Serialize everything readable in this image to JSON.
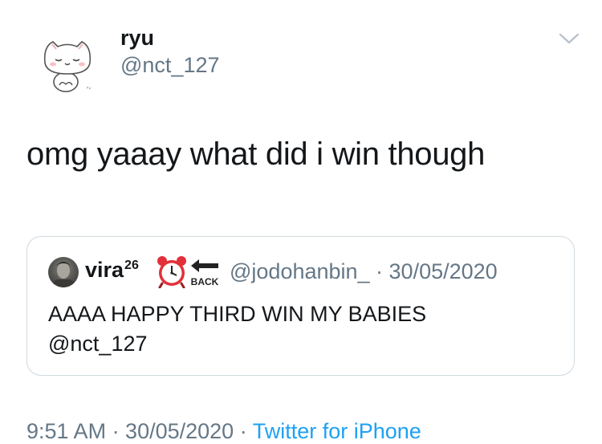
{
  "tweet": {
    "display_name": "ryu",
    "handle": "@nct_127",
    "text": "omg yaaay what did i win though",
    "avatar_icon": "cat-avatar-icon",
    "menu_icon": "chevron-down-icon"
  },
  "quote": {
    "display_name": "vira",
    "name_superscript": "26",
    "emoji": [
      "alarm-clock-icon",
      "back-arrow-icon"
    ],
    "emoji_back_text": "BACK",
    "handle_date": "@jodohanbin_ · 30/05/2020",
    "text_line1": "AAAA HAPPY THIRD WIN MY BABIES",
    "text_line2": "@nct_127"
  },
  "footer": {
    "time_date": "9:51 AM · 30/05/2020 · ",
    "source": "Twitter for iPhone"
  },
  "colors": {
    "text_primary": "#14171a",
    "text_secondary": "#657786",
    "link_blue": "#1da1f2",
    "card_border": "#cfd9de"
  }
}
